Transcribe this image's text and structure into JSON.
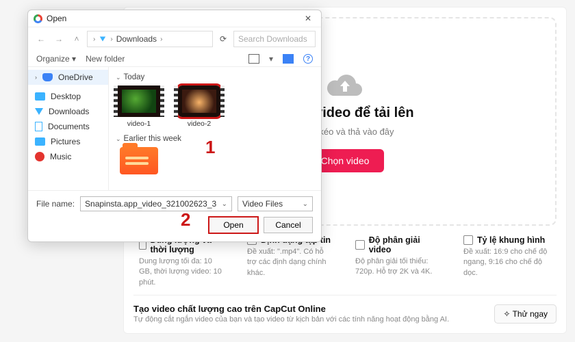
{
  "page": {
    "upload": {
      "title": "Chọn video để tải lên",
      "subtitle": "Hoặc kéo và thả vào đây",
      "button": "Chọn video"
    },
    "info": [
      {
        "title": "Dung lượng và thời lượng",
        "desc": "Dung lượng tối đa: 10 GB, thời lượng video: 10 phút."
      },
      {
        "title": "Định dạng tập tin",
        "desc": "Đề xuất: \".mp4\". Có hỗ trợ các định dạng chính khác."
      },
      {
        "title": "Độ phân giải video",
        "desc": "Độ phân giải tối thiểu: 720p. Hỗ trợ 2K và 4K."
      },
      {
        "title": "Tỷ lệ khung hình",
        "desc": "Đề xuất: 16:9 cho chế độ ngang, 9:16 cho chế độ dọc."
      }
    ],
    "promo": {
      "title": "Tạo video chất lượng cao trên CapCut Online",
      "desc": "Tự động cắt ngắn video của bạn và tạo video từ kịch bản với các tính năng hoạt động bằng AI.",
      "button": "Thử ngay",
      "button_icon": "✧"
    }
  },
  "dialog": {
    "title": "Open",
    "breadcrumb": {
      "sep": "›",
      "folder": "Downloads"
    },
    "search_placeholder": "Search Downloads",
    "toolbar": {
      "organize": "Organize ▾",
      "new_folder": "New folder"
    },
    "sidebar": [
      {
        "label": "OneDrive",
        "icon": "cloud",
        "selected": true
      },
      {
        "label": "Desktop",
        "icon": "desktop"
      },
      {
        "label": "Downloads",
        "icon": "down"
      },
      {
        "label": "Documents",
        "icon": "doc"
      },
      {
        "label": "Pictures",
        "icon": "pic"
      },
      {
        "label": "Music",
        "icon": "mus"
      }
    ],
    "groups": [
      {
        "header": "Today",
        "items": [
          {
            "name": "video-1"
          },
          {
            "name": "video-2",
            "selected": true
          }
        ]
      },
      {
        "header": "Earlier this week"
      }
    ],
    "footer": {
      "filename_label": "File name:",
      "filename_value": "Snapinsta.app_video_321002623_3",
      "filter": "Video Files",
      "open": "Open",
      "cancel": "Cancel"
    }
  },
  "annotations": {
    "one": "1",
    "two": "2"
  }
}
